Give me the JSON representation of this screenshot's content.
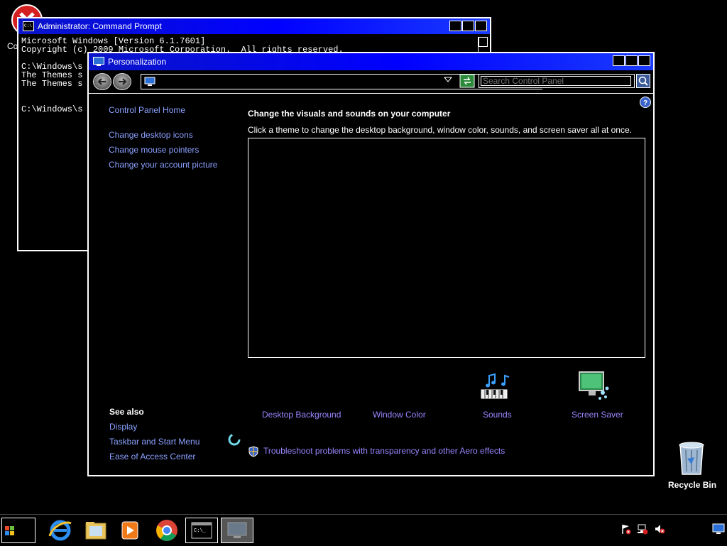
{
  "desktop": {
    "partial_icon_label": "Co",
    "recycle_bin_label": "Recycle Bin"
  },
  "cmd_window": {
    "title": "Administrator: Command Prompt",
    "lines": [
      "Microsoft Windows [Version 6.1.7601]",
      "Copyright (c) 2009 Microsoft Corporation.  All rights reserved.",
      "",
      "C:\\Windows\\s",
      "The Themes s",
      "The Themes s",
      "",
      "",
      "C:\\Windows\\s"
    ]
  },
  "personalization": {
    "title": "Personalization",
    "search_placeholder": "Search Control Panel",
    "sidebar": {
      "home": "Control Panel Home",
      "links": [
        "Change desktop icons",
        "Change mouse pointers",
        "Change your account picture"
      ],
      "see_also_heading": "See also",
      "see_also_links": [
        "Display",
        "Taskbar and Start Menu",
        "Ease of Access Center"
      ]
    },
    "main": {
      "heading": "Change the visuals and sounds on your computer",
      "description": "Click a theme to change the desktop background, window color, sounds, and screen saver all at once."
    },
    "bottom_links": {
      "desktop_background": "Desktop Background",
      "window_color": "Window Color",
      "sounds": "Sounds",
      "screen_saver": "Screen Saver"
    },
    "troubleshoot": "Troubleshoot problems with transparency and other Aero effects"
  },
  "taskbar": {
    "pinned": [
      "start-button",
      "internet-explorer-icon",
      "file-explorer-icon",
      "media-player-icon",
      "chrome-icon",
      "command-prompt-icon",
      "personalization-icon"
    ],
    "active": [
      "command-prompt-icon",
      "personalization-icon"
    ]
  },
  "colors": {
    "titlebar": "#0000ff",
    "link": "#8aa0ff"
  }
}
